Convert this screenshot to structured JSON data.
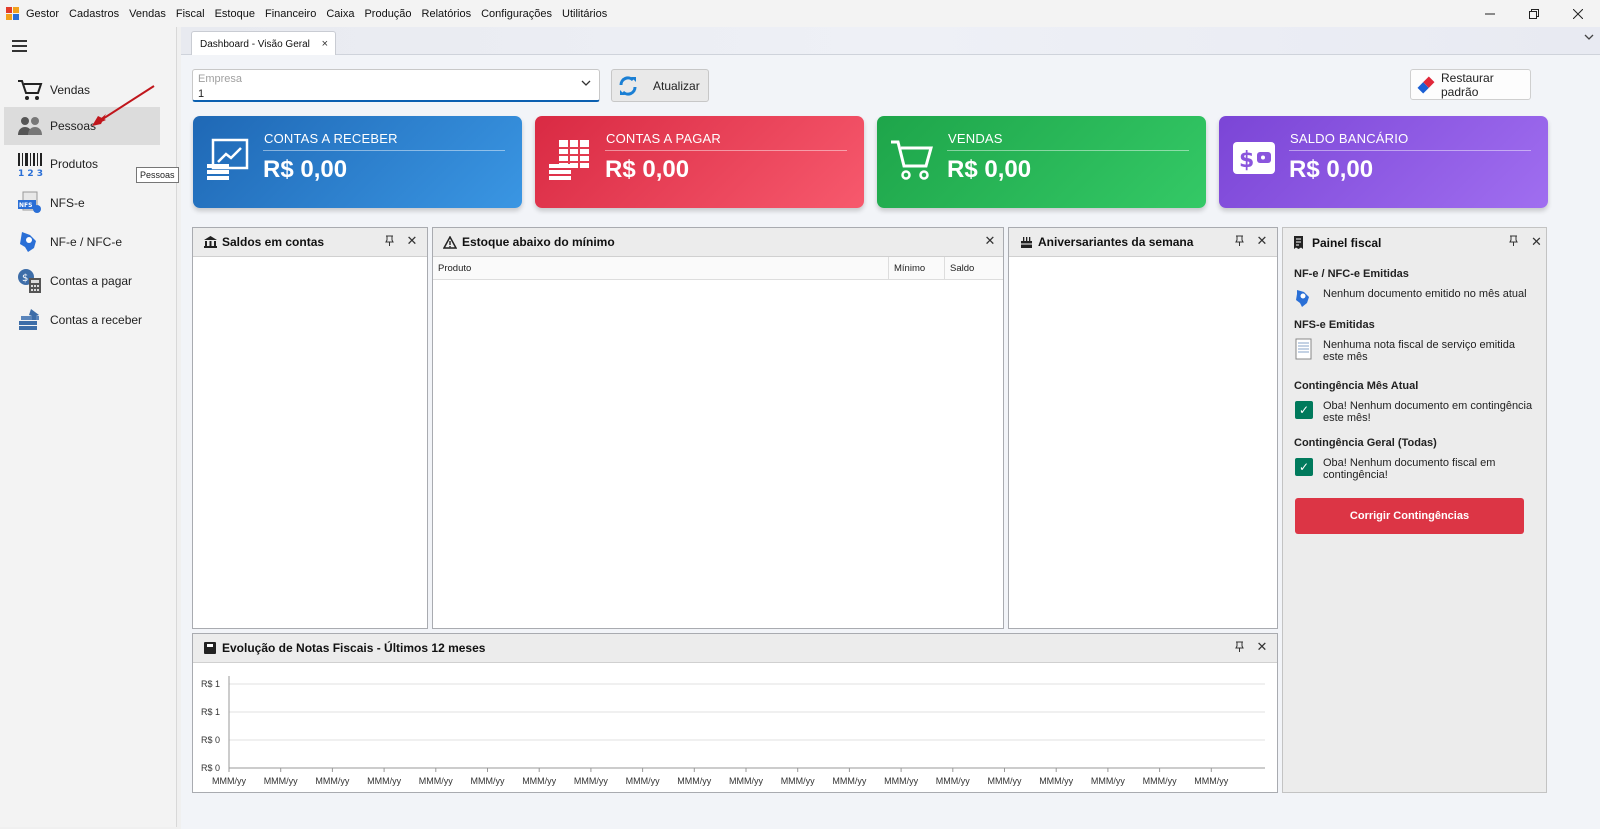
{
  "menu": [
    "Gestor",
    "Cadastros",
    "Vendas",
    "Fiscal",
    "Estoque",
    "Financeiro",
    "Caixa",
    "Produção",
    "Relatórios",
    "Configurações",
    "Utilitários"
  ],
  "sidebar": {
    "items": [
      {
        "label": "Vendas",
        "icon": "shopping-cart-icon"
      },
      {
        "label": "Pessoas",
        "icon": "people-icon"
      },
      {
        "label": "Produtos",
        "icon": "barcode-icon"
      },
      {
        "label": "NFS-e",
        "icon": "nfse-document-icon"
      },
      {
        "label": "NF-e / NFC-e",
        "icon": "nfe-brazil-icon"
      },
      {
        "label": "Contas a pagar",
        "icon": "calculator-money-icon"
      },
      {
        "label": "Contas a receber",
        "icon": "money-stack-icon"
      }
    ],
    "tooltip": "Pessoas"
  },
  "tab": {
    "label": "Dashboard - Visão Geral",
    "close": "×"
  },
  "filter": {
    "empresa_label": "Empresa",
    "empresa_value": "1",
    "atualizar": "Atualizar",
    "restaurar": "Restaurar padrão"
  },
  "cards": [
    {
      "title": "CONTAS A RECEBER",
      "amount": "R$ 0,00",
      "color": "#2f7fd0"
    },
    {
      "title": "CONTAS A PAGAR",
      "amount": "R$ 0,00",
      "color": "#e8384f"
    },
    {
      "title": "VENDAS",
      "amount": "R$ 0,00",
      "color": "#27b454"
    },
    {
      "title": "SALDO BANCÁRIO",
      "amount": "R$ 0,00",
      "color": "#8a55dd"
    }
  ],
  "panels": {
    "saldos": {
      "title": "Saldos em contas"
    },
    "estoque": {
      "title": "Estoque abaixo do mínimo",
      "columns": [
        "Produto",
        "Mínimo",
        "Saldo"
      ]
    },
    "aniversariantes": {
      "title": "Aniversariantes da semana"
    },
    "evolucao": {
      "title": "Evolução de Notas Fiscais - Últimos 12 meses"
    }
  },
  "fiscal": {
    "title": "Painel fiscal",
    "nfe_title": "NF-e / NFC-e Emitidas",
    "nfe_text": "Nenhum documento emitido no mês atual",
    "nfse_title": "NFS-e Emitidas",
    "nfse_text": "Nenhuma nota fiscal de serviço emitida este mês",
    "cont_mes_title": "Contingência Mês Atual",
    "cont_mes_text": "Oba! Nenhum documento em contingência este mês!",
    "cont_geral_title": "Contingência Geral (Todas)",
    "cont_geral_text": "Oba! Nenhum documento fiscal em contingência!",
    "button": "Corrigir Contingências"
  },
  "chart_data": {
    "type": "line",
    "title": "Evolução de Notas Fiscais - Últimos 12 meses",
    "y_tick_labels": [
      "R$ 1",
      "R$ 1",
      "R$ 0",
      "R$ 0"
    ],
    "categories": [
      "MMM/yy",
      "MMM/yy",
      "MMM/yy",
      "MMM/yy",
      "MMM/yy",
      "MMM/yy",
      "MMM/yy",
      "MMM/yy",
      "MMM/yy",
      "MMM/yy",
      "MMM/yy",
      "MMM/yy",
      "MMM/yy",
      "MMM/yy",
      "MMM/yy",
      "MMM/yy",
      "MMM/yy",
      "MMM/yy",
      "MMM/yy",
      "MMM/yy"
    ],
    "series": [],
    "grid": true
  }
}
